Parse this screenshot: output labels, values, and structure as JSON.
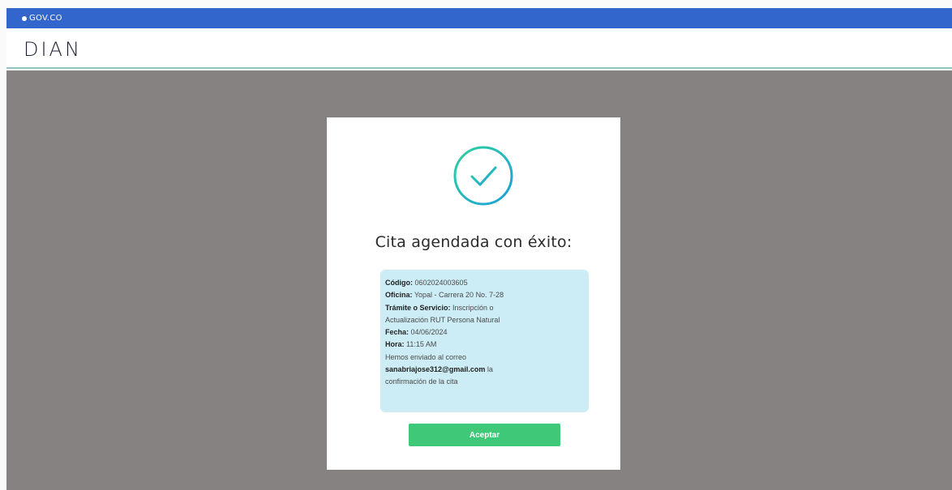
{
  "gov_bar": {
    "label": "GOV.CO",
    "color": "#3366cc"
  },
  "header": {
    "logo_text": "DIAN"
  },
  "modal": {
    "title": "Cita agendada con éxito:",
    "icon": "check-circle-icon",
    "details": {
      "codigo_label": "Código:",
      "codigo_value": " 0602024003605",
      "oficina_label": "Oficina:",
      "oficina_value": " Yopal - Carrera 20 No. 7-28",
      "tramite_label": "Trámite o Servicio:",
      "tramite_value_1": " Inscripción o",
      "tramite_value_2": "Actualización RUT Persona Natural",
      "fecha_label": "Fecha:",
      "fecha_value": " 04/06/2024",
      "hora_label": "Hora:",
      "hora_value": " 11:15 AM",
      "mensaje_1": "Hemos enviado al correo",
      "email": "sanabriajose312@gmail.com",
      "mensaje_2": " la",
      "mensaje_3": "confirmación de la cita"
    },
    "accept_label": "Aceptar"
  },
  "colors": {
    "overlay": "#858281",
    "info_box": "#cdedf6",
    "accept_button": "#3ec878",
    "icon_gradient_start": "#2fd0a0",
    "icon_gradient_end": "#1aa0d8"
  }
}
